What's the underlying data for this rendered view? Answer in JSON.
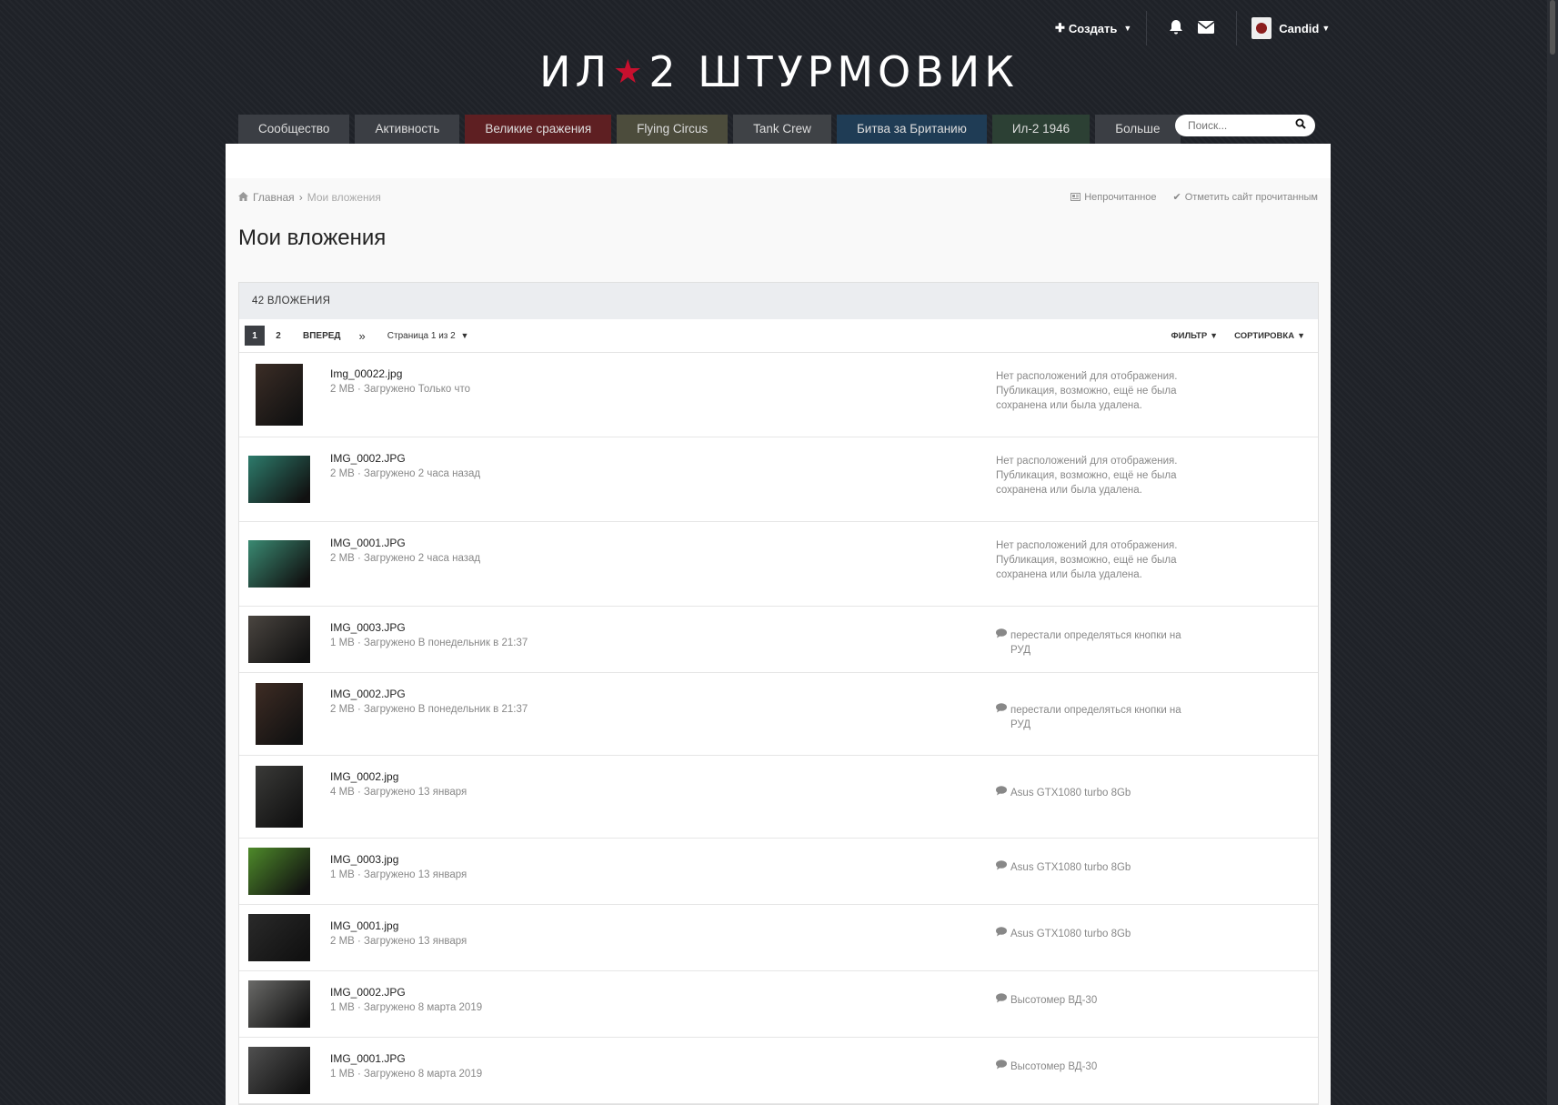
{
  "header": {
    "create_label": "Создать",
    "username": "Candid",
    "logo_left": "ИЛ",
    "logo_right": "2 ШТУРМОВИК"
  },
  "nav": {
    "tabs": [
      {
        "label": "Сообщество",
        "style": "default"
      },
      {
        "label": "Активность",
        "style": "default"
      },
      {
        "label": "Великие сражения",
        "style": "red"
      },
      {
        "label": "Flying Circus",
        "style": "olive"
      },
      {
        "label": "Tank Crew",
        "style": "grey"
      },
      {
        "label": "Битва за Британию",
        "style": "blue"
      },
      {
        "label": "Ил-2 1946",
        "style": "green"
      },
      {
        "label": "Больше",
        "style": "default"
      }
    ],
    "search_placeholder": "Поиск..."
  },
  "breadcrumb": {
    "home": "Главная",
    "current": "Мои вложения"
  },
  "markers": {
    "unread": "Непрочитанное",
    "mark_read": "Отметить сайт прочитанным"
  },
  "page_title": "Мои вложения",
  "list": {
    "count_label": "42 ВЛОЖЕНИЯ",
    "pager": {
      "pages": [
        "1",
        "2"
      ],
      "next": "ВПЕРЕД",
      "last": "»",
      "page_of": "Страница 1 из 2",
      "filter": "ФИЛЬТР",
      "sort": "СОРТИРОВКА"
    },
    "items": [
      {
        "name": "Img_00022.jpg",
        "meta": "2 MB · Загружено Только что",
        "location": "Нет расположений для отображения. Публикация, возможно, ещё не была сохранена или была удалена.",
        "linked": false,
        "orientation": "tall",
        "color": "#3b2d26"
      },
      {
        "name": "IMG_0002.JPG",
        "meta": "2 MB · Загружено 2 часа назад",
        "location": "Нет расположений для отображения. Публикация, возможно, ещё не была сохранена или была удалена.",
        "linked": false,
        "orientation": "wide",
        "color": "#2d7b6b"
      },
      {
        "name": "IMG_0001.JPG",
        "meta": "2 MB · Загружено 2 часа назад",
        "location": "Нет расположений для отображения. Публикация, возможно, ещё не была сохранена или была удалена.",
        "linked": false,
        "orientation": "wide",
        "color": "#3a8a72"
      },
      {
        "name": "IMG_0003.JPG",
        "meta": "1 MB · Загружено В понедельник в 21:37",
        "location": "перестали определяться кнопки на РУД",
        "linked": true,
        "orientation": "wide",
        "color": "#4a4540"
      },
      {
        "name": "IMG_0002.JPG",
        "meta": "2 MB · Загружено В понедельник в 21:37",
        "location": "перестали определяться кнопки на РУД",
        "linked": true,
        "orientation": "tall",
        "color": "#3e2c24"
      },
      {
        "name": "IMG_0002.jpg",
        "meta": "4 MB · Загружено 13 января",
        "location": "Asus GTX1080 turbo 8Gb",
        "linked": true,
        "orientation": "tall",
        "color": "#3a3a38"
      },
      {
        "name": "IMG_0003.jpg",
        "meta": "1 MB · Загружено 13 января",
        "location": "Asus GTX1080 turbo 8Gb",
        "linked": true,
        "orientation": "wide",
        "color": "#4e8a2a"
      },
      {
        "name": "IMG_0001.jpg",
        "meta": "2 MB · Загружено 13 января",
        "location": "Asus GTX1080 turbo 8Gb",
        "linked": true,
        "orientation": "wide",
        "color": "#2a2a2a"
      },
      {
        "name": "IMG_0002.JPG",
        "meta": "1 MB · Загружено 8 марта 2019",
        "location": "Высотомер ВД-30",
        "linked": true,
        "orientation": "wide",
        "color": "#6a6a68"
      },
      {
        "name": "IMG_0001.JPG",
        "meta": "1 MB · Загружено 8 марта 2019",
        "location": "Высотомер ВД-30",
        "linked": true,
        "orientation": "wide",
        "color": "#505050"
      }
    ]
  }
}
